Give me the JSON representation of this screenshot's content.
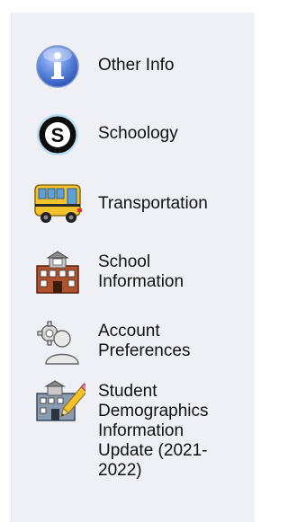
{
  "sidebar": {
    "items": [
      {
        "label": "Other Info",
        "icon": "info-icon"
      },
      {
        "label": "Schoology",
        "icon": "schoology-icon"
      },
      {
        "label": "Transportation",
        "icon": "school-bus-icon"
      },
      {
        "label": "School Information",
        "icon": "school-building-icon"
      },
      {
        "label": "Account Preferences",
        "icon": "account-preferences-icon"
      },
      {
        "label": "Student Demographics Information Update (2021-2022)",
        "icon": "demographics-update-icon"
      }
    ]
  },
  "colors": {
    "panel_bg": "#eef0f6",
    "info_blue": "#4f78d6",
    "bus_yellow": "#f3c12a",
    "school_brick": "#b0522e"
  }
}
